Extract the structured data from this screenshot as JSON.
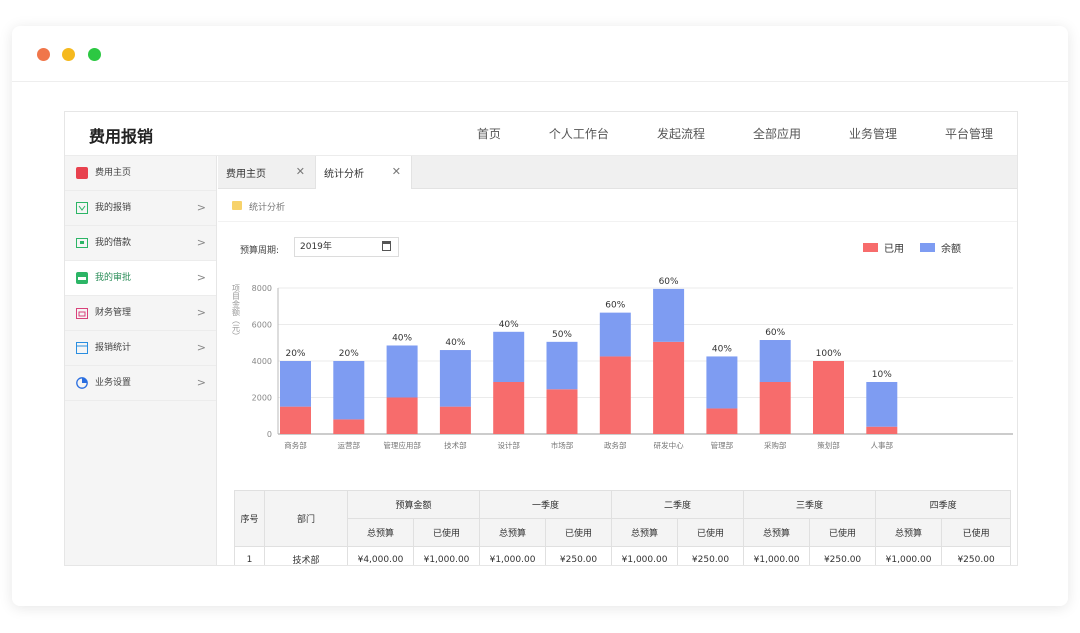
{
  "app": {
    "title": "费用报销",
    "nav": [
      "首页",
      "个人工作台",
      "发起流程",
      "全部应用",
      "业务管理",
      "平台管理"
    ]
  },
  "sidebar": {
    "items": [
      {
        "label": "费用主页",
        "icon": "home-icon",
        "color": "#e8414e"
      },
      {
        "label": "我的报销",
        "icon": "receipt-icon",
        "color": "#2cb566"
      },
      {
        "label": "我的借款",
        "icon": "money-icon",
        "color": "#2cb566"
      },
      {
        "label": "我的审批",
        "icon": "approval-icon",
        "color": "#2cb566"
      },
      {
        "label": "财务管理",
        "icon": "calendar-icon",
        "color": "#d9417a"
      },
      {
        "label": "报销统计",
        "icon": "stats-icon",
        "color": "#2a8ee0"
      },
      {
        "label": "业务设置",
        "icon": "pie-icon",
        "color": "#2a6ee0"
      }
    ],
    "active_index": 3
  },
  "tabs": [
    {
      "label": "费用主页",
      "close": "✕"
    },
    {
      "label": "统计分析",
      "close": "✕"
    }
  ],
  "breadcrumb": "统计分析",
  "filter": {
    "label": "预算周期:",
    "value": "2019年"
  },
  "legend": {
    "used": "已用",
    "remaining": "余额"
  },
  "colors": {
    "used": "#f76c6c",
    "remaining": "#7e9cf2",
    "accent": "#2c8e5a"
  },
  "chart_data": {
    "type": "bar",
    "stacked": true,
    "ylabel": "项目金额（元）",
    "ylim": [
      0,
      8000
    ],
    "yticks": [
      0,
      2000,
      4000,
      6000,
      8000
    ],
    "grid": true,
    "legend_position": "top-right",
    "categories": [
      "商务部",
      "运营部",
      "管理应用部",
      "技术部",
      "设计部",
      "市场部",
      "政务部",
      "研发中心",
      "管理部",
      "采购部",
      "策划部",
      "人事部"
    ],
    "series": [
      {
        "name": "已用",
        "values": [
          1500,
          800,
          2000,
          1500,
          2850,
          2450,
          4250,
          5050,
          1400,
          2850,
          4000,
          400
        ]
      },
      {
        "name": "余额",
        "values": [
          2500,
          3200,
          2850,
          3100,
          2750,
          2600,
          2400,
          2900,
          2850,
          2300,
          0,
          2450
        ]
      }
    ],
    "data_labels": [
      "20%",
      "20%",
      "40%",
      "40%",
      "40%",
      "50%",
      "60%",
      "60%",
      "40%",
      "60%",
      "100%",
      "10%"
    ]
  },
  "table": {
    "header_row1": [
      "序号",
      "部门",
      "预算金额",
      "一季度",
      "二季度",
      "三季度",
      "四季度"
    ],
    "header_row2": [
      "总预算",
      "已使用",
      "总预算",
      "已使用",
      "总预算",
      "已使用",
      "总预算",
      "已使用",
      "总预算",
      "已使用"
    ],
    "rows": [
      [
        "1",
        "技术部",
        "¥4,000.00",
        "¥1,000.00",
        "¥1,000.00",
        "¥250.00",
        "¥1,000.00",
        "¥250.00",
        "¥1,000.00",
        "¥250.00",
        "¥1,000.00",
        "¥250.00"
      ]
    ]
  }
}
